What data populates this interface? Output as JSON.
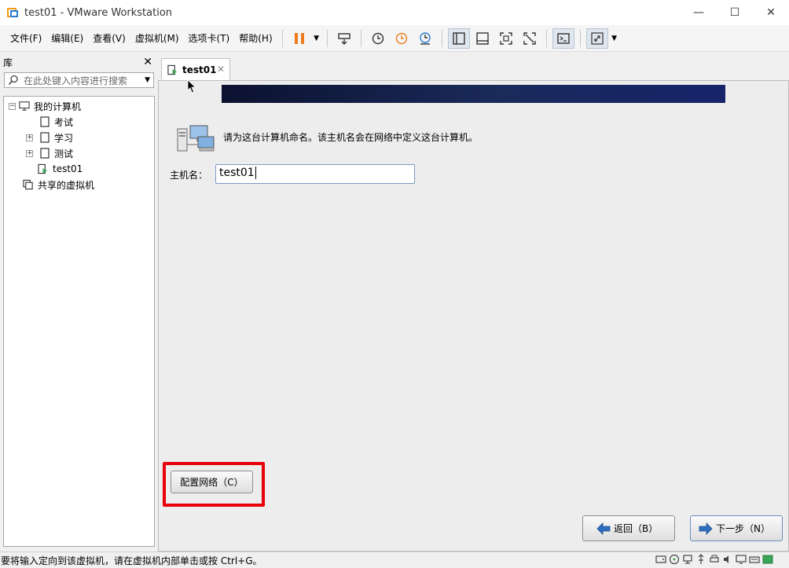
{
  "window": {
    "title": "test01 - VMware Workstation",
    "minimize": "—",
    "maximize": "☐",
    "close": "✕"
  },
  "menu": {
    "items": [
      "文件(F)",
      "编辑(E)",
      "查看(V)",
      "虚拟机(M)",
      "选项卡(T)",
      "帮助(H)"
    ]
  },
  "library": {
    "title": "库",
    "close": "✕",
    "search_placeholder": "在此处键入内容进行搜索",
    "tree": {
      "root": "我的计算机",
      "items": [
        "考试",
        "学习",
        "测试",
        "test01"
      ],
      "shared": "共享的虚拟机"
    }
  },
  "tab": {
    "label": "test01",
    "close": "✕"
  },
  "installer": {
    "prompt": "请为这台计算机命名。该主机名会在网络中定义这台计算机。",
    "hostname_label": "主机名：",
    "hostname_value": "test01",
    "configure_network": "配置网络（C）",
    "back": "返回（B）",
    "next": "下一步（N）"
  },
  "status": {
    "text": "要将输入定向到该虚拟机，请在虚拟机内部单击或按 Ctrl+G。"
  },
  "colors": {
    "highlight": "#e8000b",
    "pause": "#f07b1c",
    "banner": "#0c1230"
  }
}
